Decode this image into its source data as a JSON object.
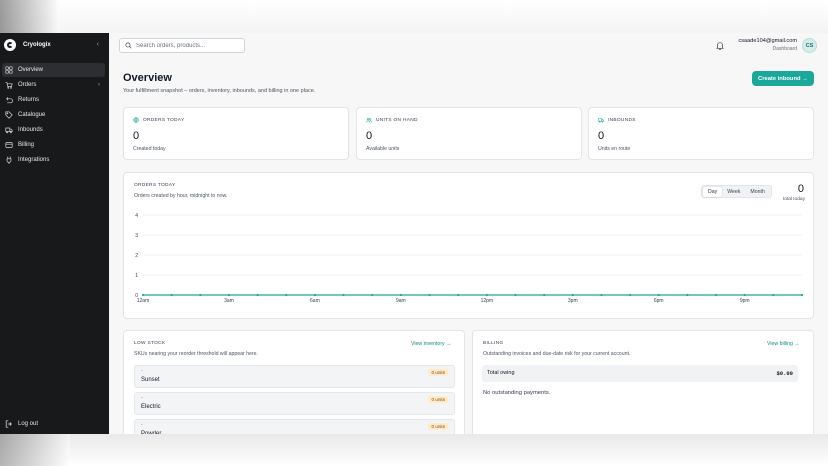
{
  "brand": {
    "name": "Cryologix"
  },
  "nav": [
    {
      "label": "Overview",
      "icon": "grid-icon",
      "active": true
    },
    {
      "label": "Orders",
      "icon": "cart-icon",
      "has_children": true
    },
    {
      "label": "Returns",
      "icon": "return-icon"
    },
    {
      "label": "Catalogue",
      "icon": "tag-icon"
    },
    {
      "label": "Inbounds",
      "icon": "truck-icon"
    },
    {
      "label": "Billing",
      "icon": "card-icon"
    },
    {
      "label": "Integrations",
      "icon": "plug-icon"
    }
  ],
  "logout_label": "Log out",
  "search": {
    "placeholder": "Search orders, products..."
  },
  "user": {
    "email": "csaade104@gmail.com",
    "role": "Dashboard",
    "initials": "CS"
  },
  "page": {
    "title": "Overview",
    "subtitle": "Your fulfillment snapshot – orders, inventory, inbounds, and billing in one place.",
    "create_label": "Create inbound →"
  },
  "stats": [
    {
      "label": "ORDERS TODAY",
      "value": "0",
      "sub": "Created today",
      "icon": "globe-icon"
    },
    {
      "label": "UNITS ON HAND",
      "value": "0",
      "sub": "Available units",
      "icon": "users-icon"
    },
    {
      "label": "INBOUNDS",
      "value": "0",
      "sub": "Units en route",
      "icon": "truck-icon"
    }
  ],
  "orders_chart": {
    "title": "ORDERS TODAY",
    "subtitle": "Orders created by hour, midnight to now.",
    "ranges": [
      "Day",
      "Week",
      "Month"
    ],
    "active_range": "Day",
    "total_value": "0",
    "total_label": "total today"
  },
  "chart_data": {
    "type": "line",
    "x_tick_labels": [
      "12am",
      "3am",
      "6am",
      "9am",
      "12pm",
      "3pm",
      "6pm",
      "9pm"
    ],
    "y_tick_labels": [
      "0",
      "1",
      "2",
      "3",
      "4"
    ],
    "ylim": [
      0,
      4
    ],
    "grid": true,
    "color": "#1aa89a",
    "series": [
      {
        "values": [
          0,
          0,
          0,
          0,
          0,
          0,
          0,
          0,
          0,
          0,
          0,
          0,
          0,
          0,
          0,
          0,
          0,
          0,
          0,
          0,
          0,
          0,
          0,
          0
        ]
      }
    ]
  },
  "low_stock": {
    "title": "LOW STOCK",
    "link": "View inventory →",
    "subtitle": "SKUs nearing your reorder threshold will appear here.",
    "items": [
      {
        "dash": "-",
        "name": "Sunset",
        "badge": "0 units"
      },
      {
        "dash": "-",
        "name": "Electric",
        "badge": "0 units"
      },
      {
        "dash": "-",
        "name": "Powder",
        "badge": "0 units"
      }
    ]
  },
  "billing": {
    "title": "BILLING",
    "link": "View billing →",
    "subtitle": "Outstanding invoices and due-date risk for your current account.",
    "owing_label": "Total owing",
    "owing_value": "$0.00",
    "empty_text": "No outstanding payments."
  }
}
